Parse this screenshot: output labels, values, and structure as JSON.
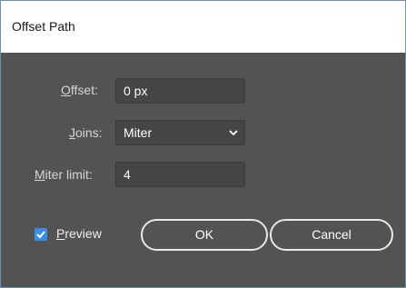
{
  "window": {
    "title": "Offset Path"
  },
  "offset": {
    "label_pre": "",
    "label_ul": "O",
    "label_post": "ffset:",
    "value": "0 px"
  },
  "joins": {
    "label_ul": "J",
    "label_post": "oins:",
    "value": "Miter"
  },
  "miter_limit": {
    "label_ul": "M",
    "label_post": "iter limit:",
    "value": "4"
  },
  "preview": {
    "label_ul": "P",
    "label_post": "review",
    "checked": true
  },
  "buttons": {
    "ok": "OK",
    "cancel": "Cancel"
  },
  "icons": {
    "joins_dropdown": "chevron-down-icon",
    "preview_check": "checkmark-icon"
  },
  "colors": {
    "panel_bg": "#535353",
    "field_bg": "#454545",
    "checkbox_accent": "#3a8ee6"
  }
}
